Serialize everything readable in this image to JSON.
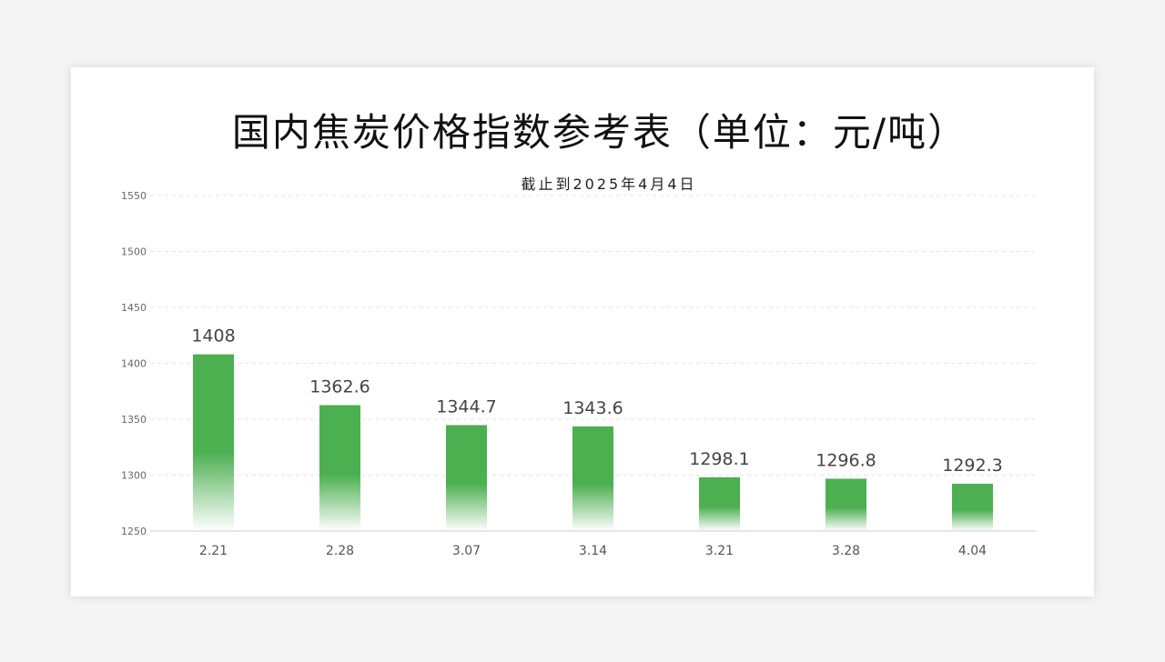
{
  "chart_data": {
    "type": "bar",
    "title": "国内焦炭价格指数参考表（单位：元/吨）",
    "subtitle": "截止到2025年4月4日",
    "categories": [
      "2.21",
      "2.28",
      "3.07",
      "3.14",
      "3.21",
      "3.28",
      "4.04"
    ],
    "values": [
      1408,
      1362.6,
      1344.7,
      1343.6,
      1298.1,
      1296.8,
      1292.3
    ],
    "value_labels": [
      "1408",
      "1362.6",
      "1344.7",
      "1343.6",
      "1298.1",
      "1296.8",
      "1292.3"
    ],
    "yticks": [
      "1250",
      "1300",
      "1350",
      "1400",
      "1450",
      "1500",
      "1550"
    ],
    "ylim": [
      1250,
      1550
    ],
    "grid": true,
    "legend": "none",
    "bar_color": "#4caf50"
  }
}
